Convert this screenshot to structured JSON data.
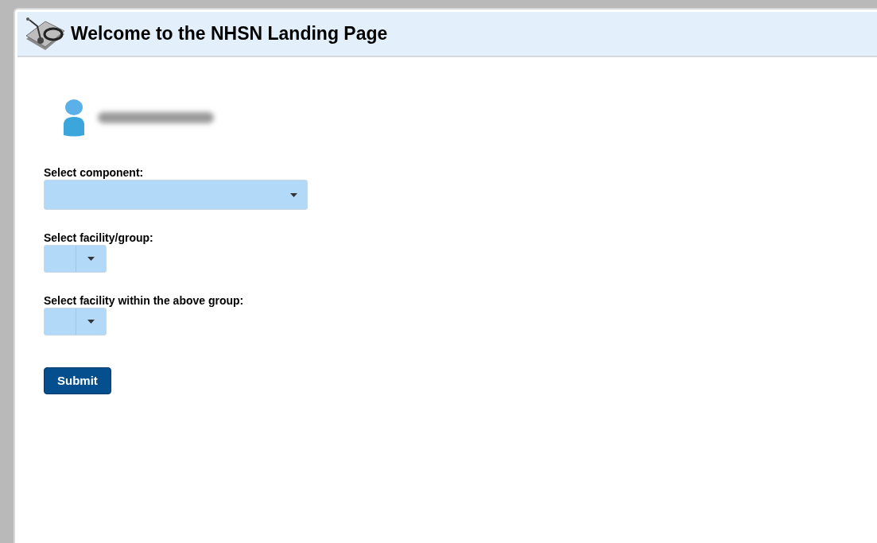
{
  "header": {
    "title": "Welcome to the NHSN Landing Page"
  },
  "fields": [
    {
      "label": "Select component:",
      "kind": "wide"
    },
    {
      "label": "Select facility/group:",
      "kind": "narrow"
    },
    {
      "label": "Select facility within the above group:",
      "kind": "narrow"
    }
  ],
  "submit_button": "Submit"
}
